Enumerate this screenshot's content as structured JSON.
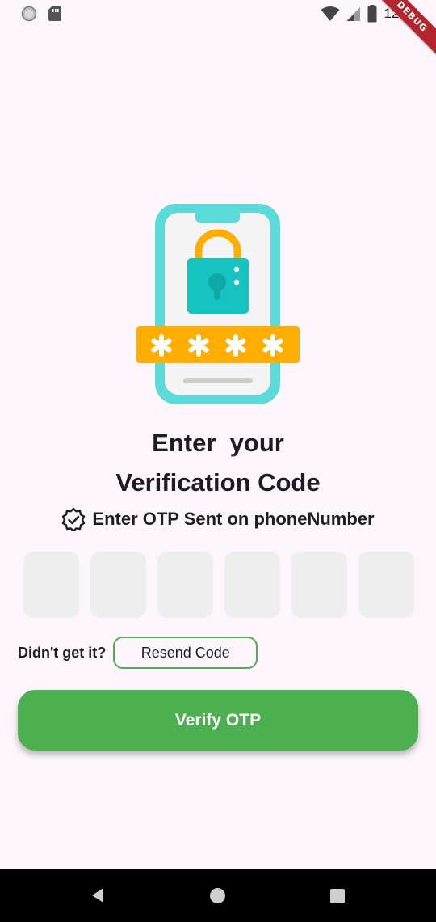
{
  "status_bar": {
    "time": "12:35",
    "left_icons": [
      "circle-icon",
      "sd-card-icon"
    ],
    "right_icons": [
      "wifi-icon",
      "signal-icon",
      "battery-icon"
    ]
  },
  "debug_banner": {
    "label": "DEBUG"
  },
  "illustration": {
    "name": "phone-lock-icon",
    "password_mask": "* * * *",
    "colors": {
      "phone": "#5ADBD9",
      "lock_body": "#17C3C0",
      "lock_shackle": "#FFAD00",
      "password_bar": "#FFAD00"
    }
  },
  "title": {
    "line1": "Enter  your",
    "line2": "Verification Code"
  },
  "subtitle": {
    "icon": "verified-badge-icon",
    "text": "Enter OTP Sent on phoneNumber"
  },
  "otp": {
    "digits": [
      "",
      "",
      "",
      "",
      "",
      ""
    ]
  },
  "resend": {
    "label": "Didn't get it?",
    "button_label": "Resend Code"
  },
  "verify_button": {
    "label": "Verify OTP"
  },
  "colors": {
    "accent": "#4CAF50",
    "background": "#FCF6FC",
    "otp_box": "#EEEEEE"
  },
  "nav_bar": {
    "icons": [
      "back-icon",
      "home-icon",
      "recents-icon"
    ]
  }
}
